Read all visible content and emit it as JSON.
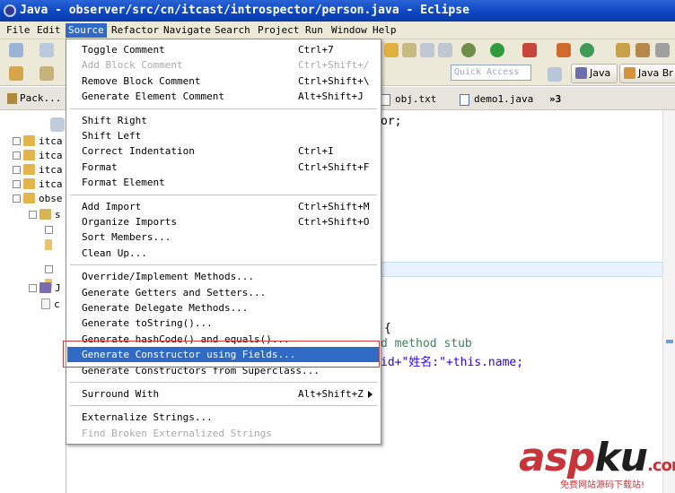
{
  "window": {
    "title": "Java - observer/src/cn/itcast/introspector/person.java - Eclipse"
  },
  "menubar": [
    {
      "label": "File",
      "active": false
    },
    {
      "label": "Edit",
      "active": false
    },
    {
      "label": "Source",
      "active": true
    },
    {
      "label": "Refactor",
      "active": false
    },
    {
      "label": "Navigate",
      "active": false
    },
    {
      "label": "Search",
      "active": false
    },
    {
      "label": "Project",
      "active": false
    },
    {
      "label": "Run",
      "active": false
    },
    {
      "label": "Window",
      "active": false
    },
    {
      "label": "Help",
      "active": false
    }
  ],
  "toolbar": {
    "quick_access_placeholder": "Quick Access",
    "perspective_java": "Java",
    "perspective_java_browsing": "Java Br"
  },
  "package_explorer": {
    "tab_label": "Pack...",
    "tree": [
      {
        "label": "itca"
      },
      {
        "label": "itca"
      },
      {
        "label": "itca"
      },
      {
        "label": "itca"
      },
      {
        "label": "obse"
      },
      {
        "label": "s"
      },
      {
        "label": "J"
      },
      {
        "label": "c"
      }
    ]
  },
  "editor": {
    "tabs": [
      {
        "label": "obj.txt"
      },
      {
        "label": "demo1.java"
      },
      {
        "label": "»3"
      }
    ],
    "code_lines": [
      {
        "text": "or;",
        "color": "#000000"
      },
      {
        "text": "{",
        "color": "#000000"
      },
      {
        "text": "d method stub",
        "color": "#3f7f5f"
      },
      {
        "text": "id+\"姓名:\"+this.name;",
        "color": "#2a00ff"
      }
    ]
  },
  "source_menu": {
    "items": [
      {
        "label": "Toggle Comment",
        "shortcut": "Ctrl+7",
        "disabled": false,
        "selected": false,
        "submenu": false
      },
      {
        "label": "Add Block Comment",
        "shortcut": "Ctrl+Shift+/",
        "disabled": true,
        "selected": false,
        "submenu": false
      },
      {
        "label": "Remove Block Comment",
        "shortcut": "Ctrl+Shift+\\",
        "disabled": false,
        "selected": false,
        "submenu": false
      },
      {
        "label": "Generate Element Comment",
        "shortcut": "Alt+Shift+J",
        "disabled": false,
        "selected": false,
        "submenu": false
      },
      {
        "separator": true
      },
      {
        "label": "Shift Right",
        "shortcut": "",
        "disabled": false,
        "selected": false,
        "submenu": false
      },
      {
        "label": "Shift Left",
        "shortcut": "",
        "disabled": false,
        "selected": false,
        "submenu": false
      },
      {
        "label": "Correct Indentation",
        "shortcut": "Ctrl+I",
        "disabled": false,
        "selected": false,
        "submenu": false
      },
      {
        "label": "Format",
        "shortcut": "Ctrl+Shift+F",
        "disabled": false,
        "selected": false,
        "submenu": false
      },
      {
        "label": "Format Element",
        "shortcut": "",
        "disabled": false,
        "selected": false,
        "submenu": false
      },
      {
        "separator": true
      },
      {
        "label": "Add Import",
        "shortcut": "Ctrl+Shift+M",
        "disabled": false,
        "selected": false,
        "submenu": false
      },
      {
        "label": "Organize Imports",
        "shortcut": "Ctrl+Shift+O",
        "disabled": false,
        "selected": false,
        "submenu": false
      },
      {
        "label": "Sort Members...",
        "shortcut": "",
        "disabled": false,
        "selected": false,
        "submenu": false
      },
      {
        "label": "Clean Up...",
        "shortcut": "",
        "disabled": false,
        "selected": false,
        "submenu": false
      },
      {
        "separator": true
      },
      {
        "label": "Override/Implement Methods...",
        "shortcut": "",
        "disabled": false,
        "selected": false,
        "submenu": false
      },
      {
        "label": "Generate Getters and Setters...",
        "shortcut": "",
        "disabled": false,
        "selected": false,
        "submenu": false
      },
      {
        "label": "Generate Delegate Methods...",
        "shortcut": "",
        "disabled": false,
        "selected": false,
        "submenu": false
      },
      {
        "label": "Generate toString()...",
        "shortcut": "",
        "disabled": false,
        "selected": false,
        "submenu": false
      },
      {
        "label": "Generate hashCode() and equals()...",
        "shortcut": "",
        "disabled": false,
        "selected": false,
        "submenu": false
      },
      {
        "label": "Generate Constructor using Fields...",
        "shortcut": "",
        "disabled": false,
        "selected": true,
        "submenu": false
      },
      {
        "label": "Generate Constructors from Superclass...",
        "shortcut": "",
        "disabled": false,
        "selected": false,
        "submenu": false
      },
      {
        "separator": true
      },
      {
        "label": "Surround With",
        "shortcut": "Alt+Shift+Z",
        "disabled": false,
        "selected": false,
        "submenu": true
      },
      {
        "separator": true
      },
      {
        "label": "Externalize Strings...",
        "shortcut": "",
        "disabled": false,
        "selected": false,
        "submenu": false
      },
      {
        "label": "Find Broken Externalized Strings",
        "shortcut": "",
        "disabled": true,
        "selected": false,
        "submenu": false
      }
    ]
  },
  "watermark": {
    "logo_text": "aspku",
    "logo_dot": ".com",
    "tagline": "免费网站源码下载站!",
    "colors": {
      "asp": "#c7343a",
      "ku": "#1f1f1f",
      "com": "#c7343a"
    }
  },
  "colors": {
    "title_bar": "#0c45c0",
    "menu_highlight": "#316ac5",
    "annotation_box": "#d33a3a"
  }
}
